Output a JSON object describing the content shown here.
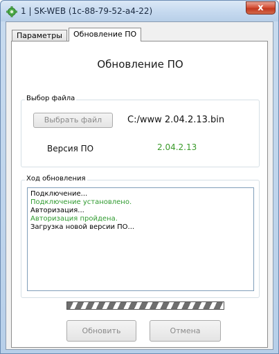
{
  "window": {
    "title": "1  |  SK-WEB (1c-88-79-52-a4-22)",
    "close_label": "x",
    "accent_color": "#c2381f"
  },
  "tabs": [
    {
      "label": "Параметры",
      "active": false
    },
    {
      "label": "Обновление ПО",
      "active": true
    }
  ],
  "page": {
    "title": "Обновление ПО"
  },
  "file_group": {
    "label": "Выбор файла",
    "pick_button": "Выбрать файл",
    "file_path": "C:/www 2.04.2.13.bin",
    "version_label": "Версия ПО",
    "version_value": "2.04.2.13",
    "version_color": "#3a9a2a"
  },
  "progress_group": {
    "label": "Ход обновления",
    "log": [
      {
        "text": "Подключение...",
        "color": "#000000"
      },
      {
        "text": "Подключение установлено.",
        "color": "#2e9a2e"
      },
      {
        "text": "Авторизация...",
        "color": "#000000"
      },
      {
        "text": "Авторизация пройдена.",
        "color": "#2e9a2e"
      },
      {
        "text": "Загрузка новой версии ПО...",
        "color": "#000000"
      }
    ]
  },
  "progress": {
    "value": 1.0
  },
  "buttons": {
    "update_label": "Обновить",
    "cancel_label": "Отмена"
  }
}
